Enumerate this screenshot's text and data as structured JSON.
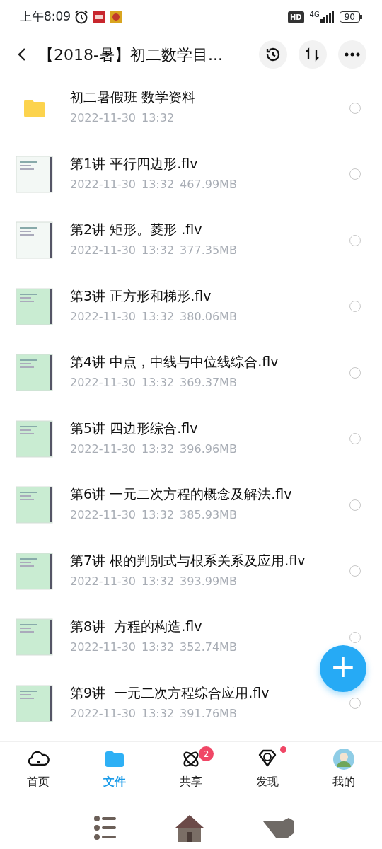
{
  "status_bar": {
    "time": "上午8:09",
    "hd": "HD",
    "network": "4G",
    "battery": "90"
  },
  "header": {
    "title": "【2018-暑】初二数学目..."
  },
  "files": [
    {
      "kind": "folder",
      "name": "初二暑假班 数学资料",
      "date": "2022-11-30",
      "time": "13:32",
      "selected": false
    },
    {
      "kind": "video",
      "name": "第1讲 平行四边形.flv",
      "date": "2022-11-30",
      "time": "13:32",
      "size": "467.99MB",
      "color": "#f3f8f5",
      "selected": false
    },
    {
      "kind": "video",
      "name": "第2讲 矩形。菱形 .flv",
      "date": "2022-11-30",
      "time": "13:32",
      "size": "377.35MB",
      "color": "#f3f8f5",
      "selected": false
    },
    {
      "kind": "video",
      "name": "第3讲 正方形和梯形.flv",
      "date": "2022-11-30",
      "time": "13:32",
      "size": "380.06MB",
      "color": "#c9ecd2",
      "selected": false
    },
    {
      "kind": "video",
      "name": "第4讲 中点，中线与中位线综合.flv",
      "date": "2022-11-30",
      "time": "13:32",
      "size": "369.37MB",
      "color": "#c9ecd2",
      "selected": false
    },
    {
      "kind": "video",
      "name": "第5讲 四边形综合.flv",
      "date": "2022-11-30",
      "time": "13:32",
      "size": "396.96MB",
      "color": "#c9ecd2",
      "selected": false
    },
    {
      "kind": "video",
      "name": "第6讲 一元二次方程的概念及解法.flv",
      "date": "2022-11-30",
      "time": "13:32",
      "size": "385.93MB",
      "color": "#c9ecd2",
      "selected": false
    },
    {
      "kind": "video",
      "name": "第7讲 根的判别式与根系关系及应用.flv",
      "date": "2022-11-30",
      "time": "13:32",
      "size": "393.99MB",
      "color": "#c9ecd2",
      "selected": false
    },
    {
      "kind": "video",
      "name": "第8讲  方程的构造.flv",
      "date": "2022-11-30",
      "time": "13:32",
      "size": "352.74MB",
      "color": "#c9ecd2",
      "selected": false
    },
    {
      "kind": "video",
      "name": "第9讲  一元二次方程综合应用.flv",
      "date": "2022-11-30",
      "time": "13:32",
      "size": "391.76MB",
      "color": "#c9ecd2",
      "selected": false
    }
  ],
  "fab": {
    "label": "+"
  },
  "tab_bar": [
    {
      "kind": "home",
      "label": "首页",
      "selected": false
    },
    {
      "kind": "files",
      "label": "文件",
      "selected": true
    },
    {
      "kind": "share",
      "label": "共享",
      "selected": false,
      "badge": "2"
    },
    {
      "kind": "discover",
      "label": "发现",
      "selected": false,
      "dot": true
    },
    {
      "kind": "me",
      "label": "我的",
      "selected": false
    }
  ]
}
